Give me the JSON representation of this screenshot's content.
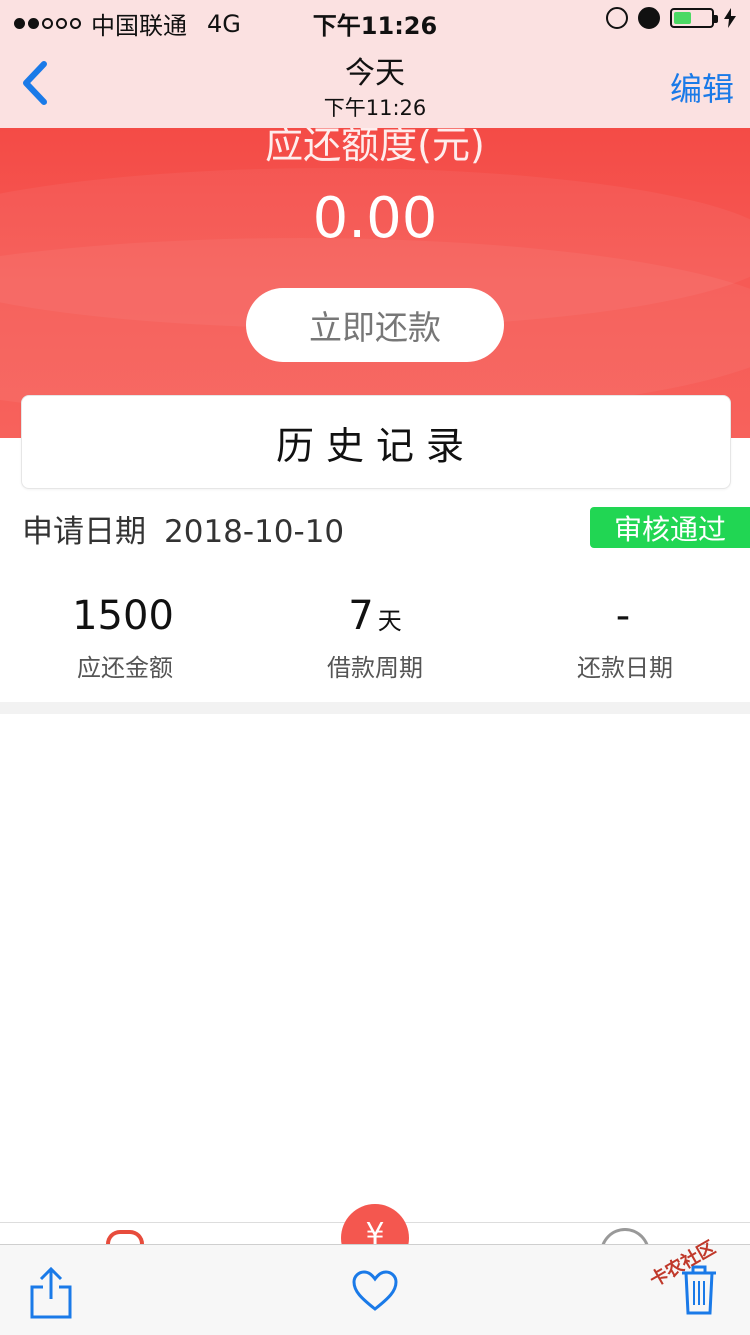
{
  "status_bar": {
    "carrier": "中国联通",
    "network": "4G",
    "time": "下午11:26"
  },
  "nav": {
    "title": "今天",
    "subtitle": "下午11:26",
    "edit_label": "编辑"
  },
  "hero": {
    "label": "应还额度(元)",
    "amount": "0.00",
    "repay_button": "立即还款"
  },
  "history": {
    "title": "历史记录"
  },
  "record": {
    "date_label": "申请日期",
    "date_value": "2018-10-10",
    "status": "审核通过",
    "stats": [
      {
        "value": "1500",
        "unit": "",
        "label": "应还金额"
      },
      {
        "value": "7",
        "unit": "天",
        "label": "借款周期"
      },
      {
        "value": "-",
        "unit": "",
        "label": "还款日期"
      }
    ]
  },
  "tabbar": {
    "fab_symbol": "¥"
  },
  "watermark": "卡农社区",
  "colors": {
    "hero_red": "#f44b46",
    "status_green": "#21d653",
    "ios_blue": "#1a7ae8"
  }
}
